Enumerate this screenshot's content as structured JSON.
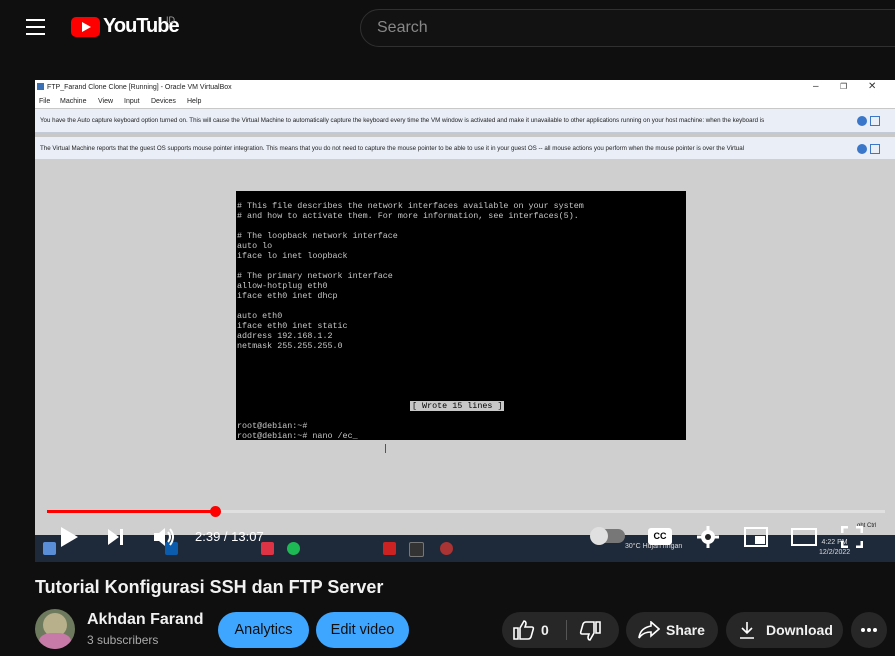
{
  "header": {
    "logo_text": "YouTube",
    "country_code": "ID",
    "search_placeholder": "Search"
  },
  "virtualbox": {
    "window_title": "FTP_Farand Clone Clone [Running] - Oracle VM VirtualBox",
    "menu": [
      "File",
      "Machine",
      "View",
      "Input",
      "Devices",
      "Help"
    ],
    "notice_keyboard": "You have the Auto capture keyboard option turned on. This will cause the Virtual Machine to automatically capture the keyboard every time the VM window is activated and make it unavailable to other applications running on your host machine: when the keyboard is",
    "notice_mouse": "The Virtual Machine reports that the guest OS supports mouse pointer integration. This means that you do not need to capture the mouse pointer to be able to use it in your guest OS -- all mouse actions you perform when the mouse pointer is over the Virtual",
    "side_text": "ght Ctrl"
  },
  "terminal": {
    "lines": [
      "# This file describes the network interfaces available on your system",
      "# and how to activate them. For more information, see interfaces(5).",
      "",
      "# The loopback network interface",
      "auto lo",
      "iface lo inet loopback",
      "",
      "# The primary network interface",
      "allow-hotplug eth0",
      "iface eth0 inet dhcp",
      "",
      "auto eth0",
      "iface eth0 inet static",
      "address 192.168.1.2",
      "netmask 255.255.255.0"
    ],
    "status": "[ Wrote 15 lines ]",
    "prompt_1": "root@debian:~#",
    "prompt_2": "root@debian:~# nano /ec_"
  },
  "taskbar": {
    "weather": "30°C  Hujan ringan",
    "clock_time": "4:22 PM",
    "clock_date": "12/2/2022"
  },
  "player": {
    "time": "2:39 / 13:07",
    "progress": 0.2
  },
  "video": {
    "title": "Tutorial Konfigurasi SSH dan FTP Server",
    "channel": "Akhdan Farand",
    "subscribers": "3 subscribers",
    "analytics_label": "Analytics",
    "edit_label": "Edit video",
    "like_count": "0",
    "share_label": "Share",
    "download_label": "Download"
  },
  "colors": {
    "accent_red": "#ff0000",
    "button_blue": "#3ea6ff",
    "pill_gray": "#272727",
    "background": "#0f0f0f"
  }
}
